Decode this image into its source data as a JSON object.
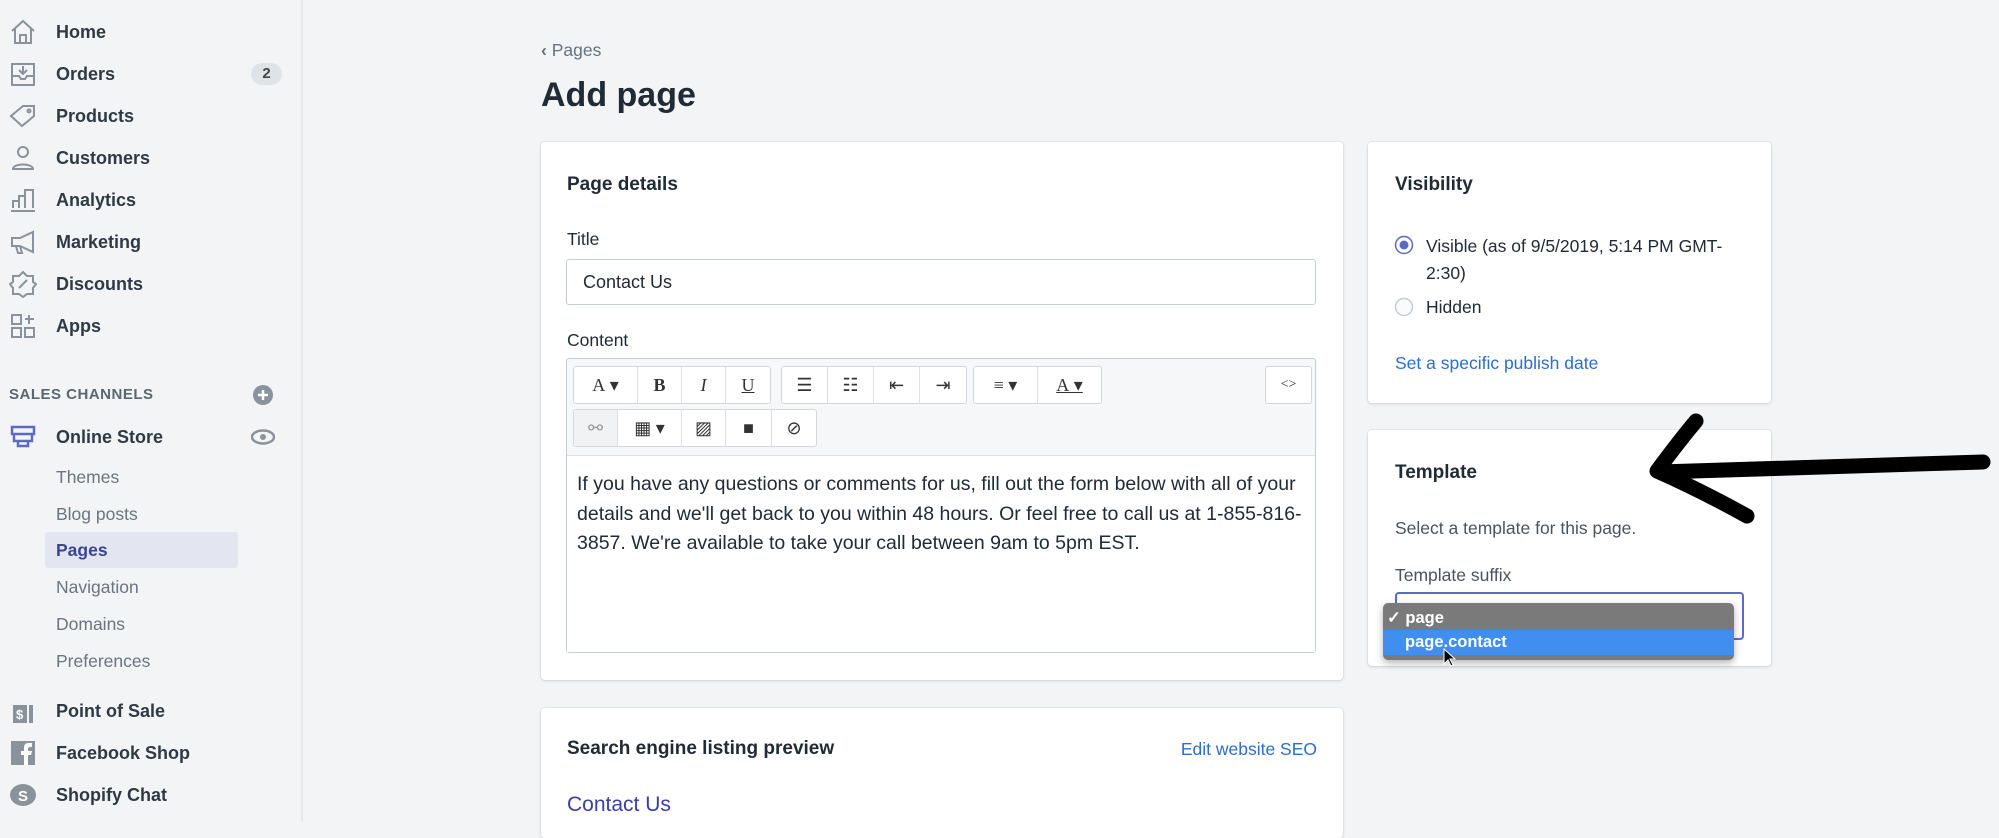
{
  "sidebar": {
    "items": [
      {
        "label": "Home",
        "icon": "home-icon"
      },
      {
        "label": "Orders",
        "icon": "orders-icon",
        "badge": "2"
      },
      {
        "label": "Products",
        "icon": "tag-icon"
      },
      {
        "label": "Customers",
        "icon": "person-icon"
      },
      {
        "label": "Analytics",
        "icon": "bar-chart-icon"
      },
      {
        "label": "Marketing",
        "icon": "megaphone-icon"
      },
      {
        "label": "Discounts",
        "icon": "discount-icon"
      },
      {
        "label": "Apps",
        "icon": "apps-icon"
      }
    ],
    "sales_channels": "SALES CHANNELS",
    "online_store": "Online Store",
    "sub": [
      "Themes",
      "Blog posts",
      "Pages",
      "Navigation",
      "Domains",
      "Preferences"
    ],
    "channels": [
      "Point of Sale",
      "Facebook Shop",
      "Shopify Chat"
    ]
  },
  "breadcrumb": "Pages",
  "title": "Add page",
  "details": {
    "heading": "Page details",
    "title_label": "Title",
    "title_value": "Contact Us",
    "content_label": "Content",
    "body": "If you have any questions or comments for us, fill out the form below with all of your details and we'll get back to you within 48 hours. Or feel free to call us at 1-855-816-3857. We're available to take your call between 9am to 5pm EST."
  },
  "seo": {
    "heading": "Search engine listing preview",
    "edit": "Edit website SEO",
    "preview_title": "Contact Us"
  },
  "visibility": {
    "heading": "Visibility",
    "visible": "Visible (as of 9/5/2019, 5:14 PM GMT-2:30)",
    "hidden": "Hidden",
    "publish_link": "Set a specific publish date"
  },
  "template": {
    "heading": "Template",
    "desc": "Select a template for this page.",
    "suffix_label": "Template suffix",
    "options": [
      "page",
      "page.contact"
    ],
    "selected": "page",
    "highlighted": "page.contact",
    "check": "✓"
  },
  "colors": {
    "accent": "#5c6ac4",
    "link": "#2c6ecb",
    "highlight": "#3f8ef0"
  }
}
